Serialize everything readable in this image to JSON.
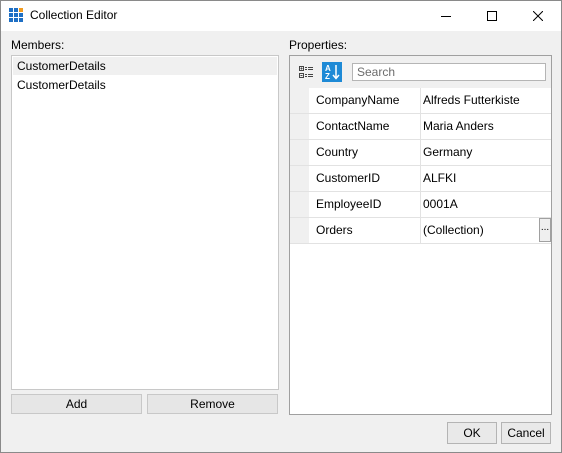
{
  "window": {
    "title": "Collection Editor"
  },
  "members": {
    "label": "Members:",
    "items": [
      "CustomerDetails",
      "CustomerDetails"
    ],
    "selected_index": 0,
    "add_label": "Add",
    "remove_label": "Remove"
  },
  "properties": {
    "label": "Properties:",
    "search_placeholder": "Search",
    "rows": [
      {
        "name": "CompanyName",
        "value": "Alfreds Futterkiste"
      },
      {
        "name": "ContactName",
        "value": "Maria Anders"
      },
      {
        "name": "Country",
        "value": "Germany"
      },
      {
        "name": "CustomerID",
        "value": "ALFKI"
      },
      {
        "name": "EmployeeID",
        "value": "0001A"
      },
      {
        "name": "Orders",
        "value": "(Collection)",
        "button": "..."
      }
    ]
  },
  "dialog": {
    "ok_label": "OK",
    "cancel_label": "Cancel"
  },
  "icons": {
    "app": "grid-app-icon",
    "categorized": "categorized-view-icon",
    "alphabetical": "sort-alphabetical-icon",
    "minimize": "minimize-icon",
    "maximize": "maximize-icon",
    "close": "close-icon"
  },
  "colors": {
    "accent": "#1e8ad6",
    "window_bg": "#f0f0f0",
    "selected_row": "#f0f0f0"
  }
}
